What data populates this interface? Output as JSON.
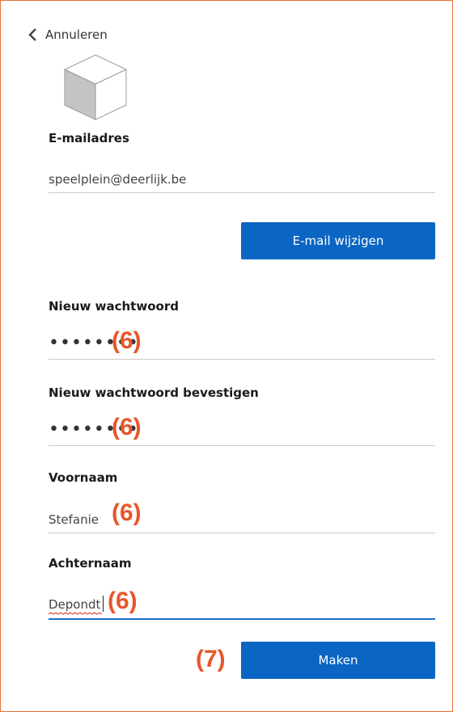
{
  "nav": {
    "back_label": "Annuleren"
  },
  "form": {
    "email": {
      "label": "E-mailadres",
      "value": "speelplein@deerlijk.be"
    },
    "change_email_button": "E-mail wijzigen",
    "new_password": {
      "label": "Nieuw wachtwoord",
      "value": "••••••••"
    },
    "confirm_password": {
      "label": "Nieuw wachtwoord bevestigen",
      "value": "••••••••"
    },
    "first_name": {
      "label": "Voornaam",
      "value": "Stefanie"
    },
    "last_name": {
      "label": "Achternaam",
      "value": "Depondt"
    },
    "submit_button": "Maken"
  },
  "annotations": {
    "step6": "(6)",
    "step7": "(7)"
  },
  "colors": {
    "accent": "#0b65c2",
    "annotation": "#e8562a",
    "border": "#e8703a",
    "focus_underline": "#1e6fc9"
  }
}
